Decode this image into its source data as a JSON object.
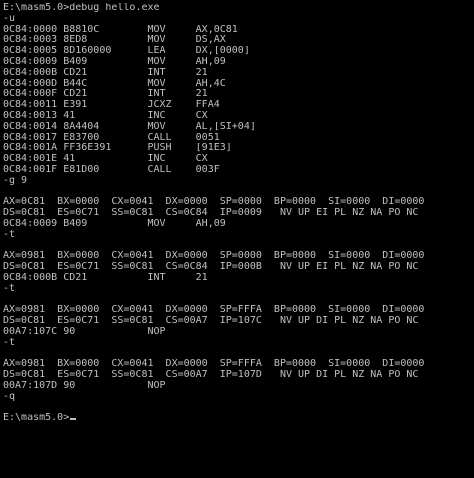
{
  "console": {
    "lines": [
      "E:\\masm5.0>debug hello.exe",
      "-u",
      "0C84:0000 B8810C        MOV     AX,0C81",
      "0C84:0003 8ED8          MOV     DS,AX",
      "0C84:0005 8D160000      LEA     DX,[0000]",
      "0C84:0009 B409          MOV     AH,09",
      "0C84:000B CD21          INT     21",
      "0C84:000D B44C          MOV     AH,4C",
      "0C84:000F CD21          INT     21",
      "0C84:0011 E391          JCXZ    FFA4",
      "0C84:0013 41            INC     CX",
      "0C84:0014 8A4404        MOV     AL,[SI+04]",
      "0C84:0017 E83700        CALL    0051",
      "0C84:001A FF36E391      PUSH    [91E3]",
      "0C84:001E 41            INC     CX",
      "0C84:001F E81D00        CALL    003F",
      "-g 9",
      "",
      "AX=0C81  BX=0000  CX=0041  DX=0000  SP=0000  BP=0000  SI=0000  DI=0000",
      "DS=0C81  ES=0C71  SS=0C81  CS=0C84  IP=0009   NV UP EI PL NZ NA PO NC",
      "0C84:0009 B409          MOV     AH,09",
      "-t",
      "",
      "AX=0981  BX=0000  CX=0041  DX=0000  SP=0000  BP=0000  SI=0000  DI=0000",
      "DS=0C81  ES=0C71  SS=0C81  CS=0C84  IP=000B   NV UP EI PL NZ NA PO NC",
      "0C84:000B CD21          INT     21",
      "-t",
      "",
      "AX=0981  BX=0000  CX=0041  DX=0000  SP=FFFA  BP=0000  SI=0000  DI=0000",
      "DS=0C81  ES=0C71  SS=0C81  CS=00A7  IP=107C   NV UP DI PL NZ NA PO NC",
      "00A7:107C 90            NOP",
      "-t",
      "",
      "AX=0981  BX=0000  CX=0041  DX=0000  SP=FFFA  BP=0000  SI=0000  DI=0000",
      "DS=0C81  ES=0C71  SS=0C81  CS=00A7  IP=107D   NV UP DI PL NZ NA PO NC",
      "00A7:107D 90            NOP",
      "-q",
      "",
      "E:\\masm5.0>"
    ]
  },
  "colors": {
    "background": "#000000",
    "text": "#c0c0c0"
  }
}
